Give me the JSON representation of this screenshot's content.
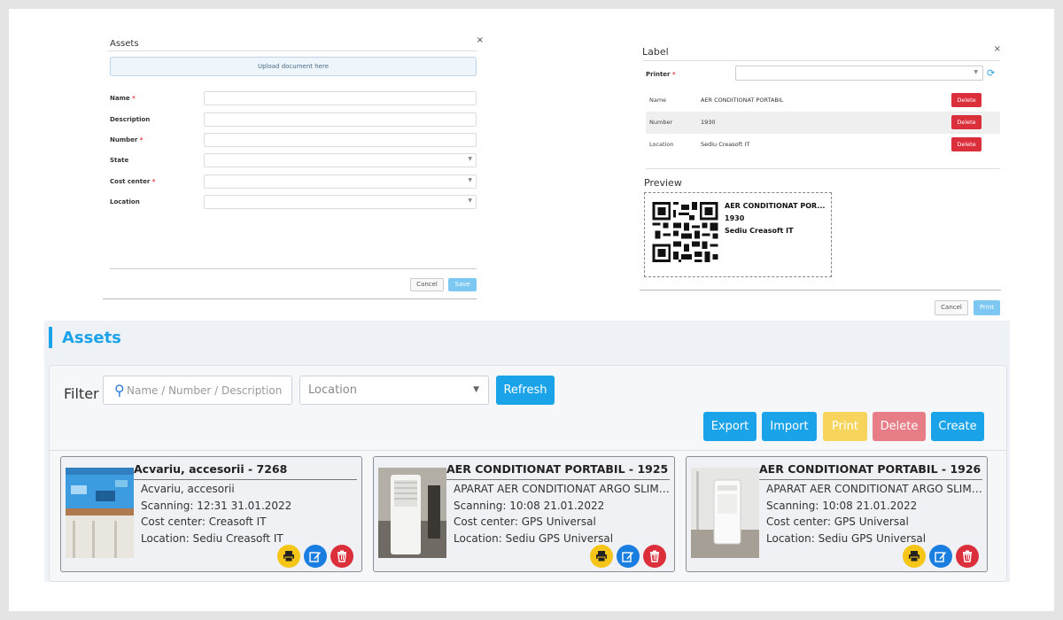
{
  "asset_form": {
    "title": "Assets",
    "close": "×",
    "upload_label": "Upload document here",
    "fields": [
      {
        "label": "Name",
        "required": "*"
      },
      {
        "label": "Description",
        "required": ""
      },
      {
        "label": "Number",
        "required": "*"
      },
      {
        "label": "State",
        "required": ""
      },
      {
        "label": "Cost center",
        "required": "*"
      },
      {
        "label": "Location",
        "required": ""
      }
    ],
    "cancel": "Cancel",
    "save": "Save"
  },
  "label_modal": {
    "title": "Label",
    "close": "×",
    "printer_label": "Printer",
    "printer_required": "*",
    "rows": [
      {
        "key": "Name",
        "value": "AER CONDITIONAT PORTABIL",
        "delete": "Delete"
      },
      {
        "key": "Number",
        "value": "1930",
        "delete": "Delete"
      },
      {
        "key": "Location",
        "value": "Sediu Creasoft IT",
        "delete": "Delete"
      }
    ],
    "preview_label": "Preview",
    "preview_lines": [
      "AER CONDITIONAT POR...",
      "1930",
      "Sediu Creasoft IT"
    ],
    "cancel": "Cancel",
    "print": "Print"
  },
  "assets_page": {
    "title": "Assets",
    "filter_label": "Filter",
    "search_placeholder": "Name / Number / Description",
    "location_placeholder": "Location",
    "refresh": "Refresh",
    "export": "Export",
    "import": "Import",
    "print": "Print",
    "delete": "Delete",
    "create": "Create",
    "accent_color": "#1aa3e8",
    "assets": [
      {
        "title": "Acvariu, accesorii - 7268",
        "description": "Acvariu, accesorii",
        "scanning": "Scanning: 12:31 31.01.2022",
        "cost_center": "Cost center: Creasoft IT",
        "location": "Location: Sediu Creasoft IT"
      },
      {
        "title": "AER CONDITIONAT PORTABIL - 1925",
        "description": "APARAT AER CONDITIONAT ARGO SLIMMY PO...",
        "scanning": "Scanning: 10:08 21.01.2022",
        "cost_center": "Cost center: GPS Universal",
        "location": "Location: Sediu GPS Universal"
      },
      {
        "title": "AER CONDITIONAT PORTABIL - 1926",
        "description": "APARAT AER CONDITIONAT ARGO SLIMMY PO...",
        "scanning": "Scanning: 10:08 21.01.2022",
        "cost_center": "Cost center: GPS Universal",
        "location": "Location: Sediu GPS Universal"
      }
    ]
  }
}
